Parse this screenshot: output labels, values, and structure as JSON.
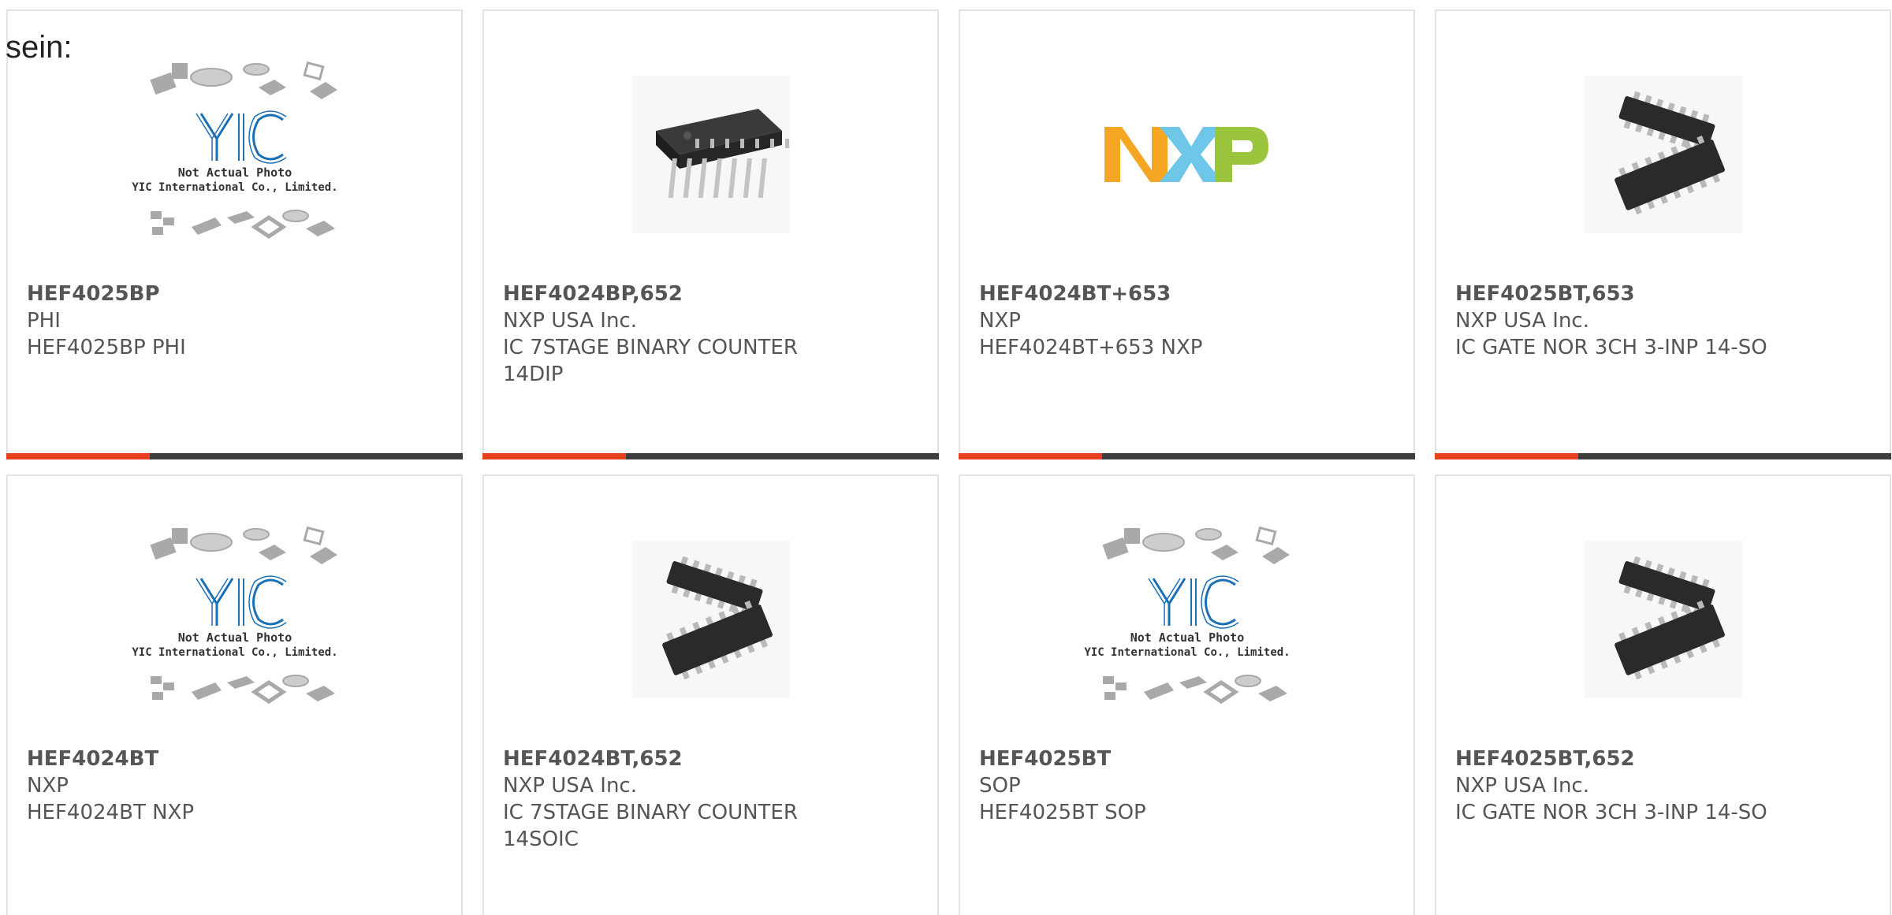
{
  "intro_text": "sein:",
  "placeholder": {
    "line1": "Not Actual Photo",
    "line2": "YIC International Co., Limited.",
    "logo": "YIC"
  },
  "brand_logo": "NXP",
  "colors": {
    "accent_bar": "#e8401c",
    "bar_base": "#3d3d3d",
    "card_border": "#e3e3e3",
    "text": "#555555",
    "yic_blue": "#1a6fb5",
    "chip_body": "#2a2a2a",
    "nxp_yellow": "#f5a623",
    "nxp_blue": "#6ec6e8",
    "nxp_green": "#9bc53d"
  },
  "products": [
    {
      "part": "HEF4025BP",
      "manufacturer": "PHI",
      "description": "HEF4025BP PHI",
      "image": "placeholder-yic"
    },
    {
      "part": "HEF4024BP,652",
      "manufacturer": "NXP USA Inc.",
      "description": "IC 7STAGE BINARY COUNTER 14DIP",
      "image": "chip-dip"
    },
    {
      "part": "HEF4024BT+653",
      "manufacturer": "NXP",
      "description": "HEF4024BT+653 NXP",
      "image": "nxp-logo"
    },
    {
      "part": "HEF4025BT,653",
      "manufacturer": "NXP USA Inc.",
      "description": "IC GATE NOR 3CH 3-INP 14-SO",
      "image": "chip-soic"
    },
    {
      "part": "HEF4024BT",
      "manufacturer": "NXP",
      "description": "HEF4024BT NXP",
      "image": "placeholder-yic"
    },
    {
      "part": "HEF4024BT,652",
      "manufacturer": "NXP USA Inc.",
      "description": "IC 7STAGE BINARY COUNTER 14SOIC",
      "image": "chip-soic"
    },
    {
      "part": "HEF4025BT",
      "manufacturer": "SOP",
      "description": "HEF4025BT SOP",
      "image": "placeholder-yic"
    },
    {
      "part": "HEF4025BT,652",
      "manufacturer": "NXP USA Inc.",
      "description": "IC GATE NOR 3CH 3-INP 14-SO",
      "image": "chip-soic"
    }
  ]
}
